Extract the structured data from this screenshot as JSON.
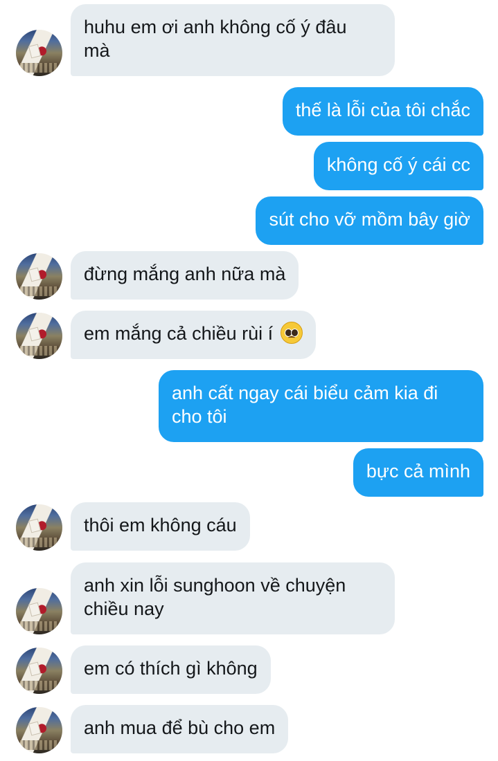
{
  "messages": [
    {
      "from": "other",
      "text": "huhu em ơi anh không cố ý đâu\nmà"
    },
    {
      "from": "me",
      "text": "thế là lỗi của tôi chắc"
    },
    {
      "from": "me",
      "text": "không cố ý cái cc"
    },
    {
      "from": "me",
      "text": "sút cho vỡ mồm bây giờ"
    },
    {
      "from": "other",
      "text": "đừng mắng anh nữa mà"
    },
    {
      "from": "other",
      "text": "em mắng cả chiều rùi í",
      "emoji": "pleading-face-emoji"
    },
    {
      "from": "me",
      "text": "anh cất ngay cái biểu cảm kia đi\ncho tôi"
    },
    {
      "from": "me",
      "text": "bực cả mình"
    },
    {
      "from": "other",
      "text": "thôi em không cáu"
    },
    {
      "from": "other",
      "text": "anh xin lỗi sunghoon về chuyện\nchiều nay"
    },
    {
      "from": "other",
      "text": "em có thích gì không"
    },
    {
      "from": "other",
      "text": "anh mua để bù cho em"
    }
  ],
  "colors": {
    "sent_bubble": "#1da1f2",
    "received_bubble": "#e6ecf0",
    "sent_text": "#ffffff",
    "received_text": "#14171a"
  }
}
